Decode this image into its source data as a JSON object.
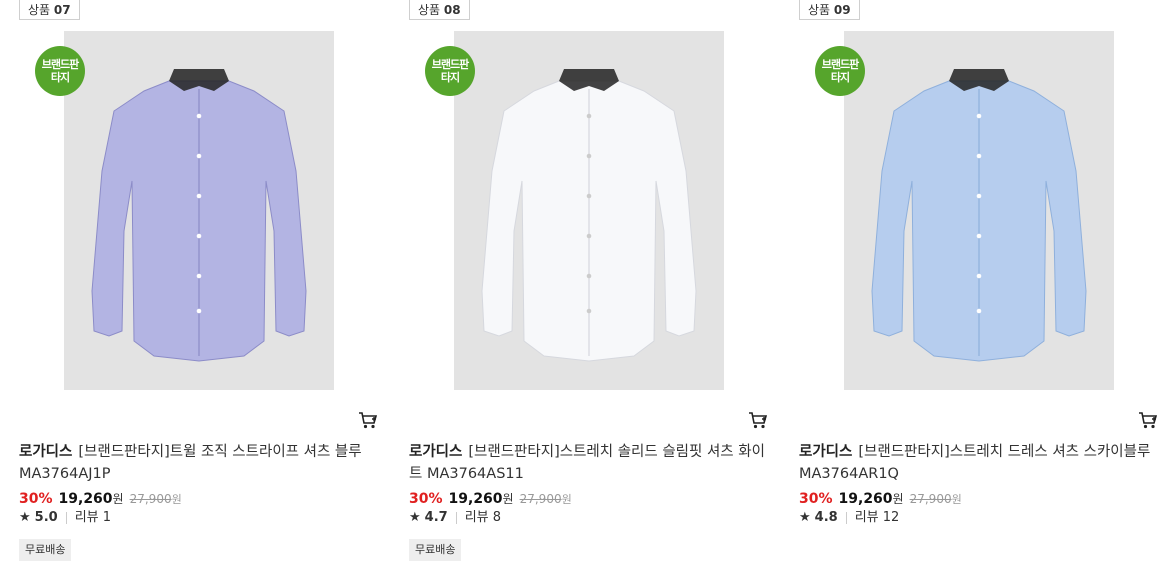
{
  "rank_prefix": "상품",
  "badge_text": "브랜드판타지",
  "products": [
    {
      "rank": "07",
      "brand": "로가디스",
      "name": "[브랜드판타지]트윌 조직 스트라이프 셔츠 블루 MA3764AJ1P",
      "discount": "30%",
      "price": "19,260",
      "currency": "원",
      "original_price": "27,900",
      "rating": "5.0",
      "review_label": "리뷰",
      "review_count": "1",
      "shipping": "무료배송",
      "shirt_color": "#b3b4e3"
    },
    {
      "rank": "08",
      "brand": "로가디스",
      "name": "[브랜드판타지]스트레치 솔리드 슬림핏 셔츠 화이트 MA3764AS11",
      "discount": "30%",
      "price": "19,260",
      "currency": "원",
      "original_price": "27,900",
      "rating": "4.7",
      "review_label": "리뷰",
      "review_count": "8",
      "shipping": "무료배송",
      "shirt_color": "#f7f8fa"
    },
    {
      "rank": "09",
      "brand": "로가디스",
      "name": "[브랜드판타지]스트레치 드레스 셔츠 스카이블루 MA3764AR1Q",
      "discount": "30%",
      "price": "19,260",
      "currency": "원",
      "original_price": "27,900",
      "rating": "4.8",
      "review_label": "리뷰",
      "review_count": "12",
      "shipping": "",
      "shirt_color": "#b6cdee"
    }
  ],
  "colors": {
    "discount": "#e02020",
    "badge": "#56a52c",
    "image_bg": "#e3e3e3"
  }
}
